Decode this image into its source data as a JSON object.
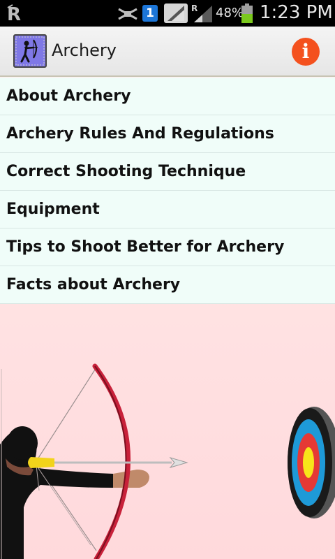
{
  "status_bar": {
    "notification_count": "1",
    "battery_percent": "48%",
    "time": "1:23 PM",
    "icons": [
      "app-r-icon",
      "mute-icon",
      "notification-badge",
      "wifi-icon",
      "signal-icon",
      "battery-icon"
    ]
  },
  "action_bar": {
    "title": "Archery",
    "logo_icon": "archer-logo-icon",
    "info_icon": "info-icon",
    "info_color": "#f4511e"
  },
  "menu": {
    "items": [
      {
        "label": "About Archery"
      },
      {
        "label": "Archery Rules And Regulations"
      },
      {
        "label": "Correct Shooting Technique"
      },
      {
        "label": "Equipment"
      },
      {
        "label": "Tips to Shoot Better for Archery"
      },
      {
        "label": "Facts about Archery"
      }
    ]
  },
  "colors": {
    "status_bar_bg": "#000000",
    "action_bar_bg": "#eeeeee",
    "menu_item_bg": "#f0fdf9",
    "illustration_bg": "#ffe4e4",
    "bow_red": "#c8213a",
    "target_blue": "#1e9ad8",
    "target_red": "#e53935",
    "target_yellow": "#f7e51a"
  }
}
